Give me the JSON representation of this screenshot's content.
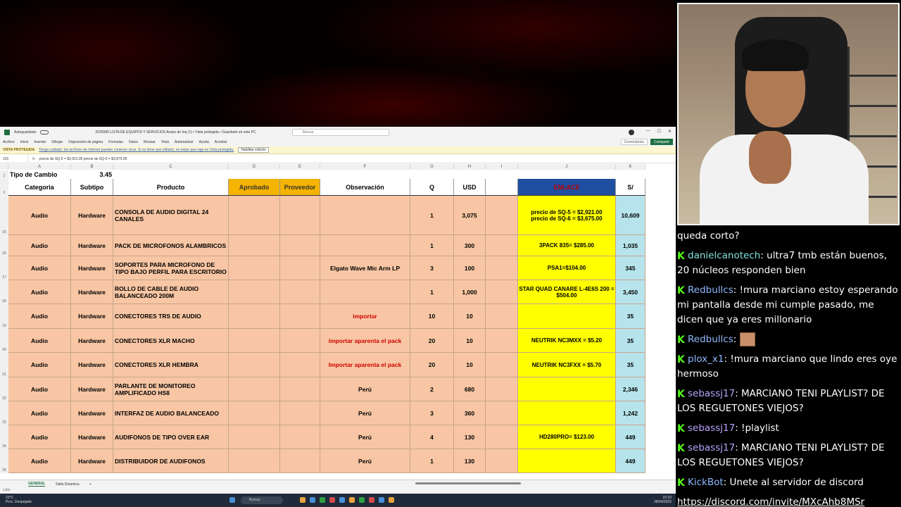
{
  "excel": {
    "title": "2025085 LISTA DE EQUIPOS Y SERVICIOS Arsiyo de Inq (1) • Vista protegida • Guardado en este PC",
    "autosave": "Autoguardado",
    "search_placeholder": "Buscar",
    "ribbon_tabs": [
      "Archivo",
      "Inicio",
      "Insertar",
      "Dibujar",
      "Disposición de página",
      "Fórmulas",
      "Datos",
      "Revisar",
      "Vista",
      "Automatizar",
      "Ayuda",
      "Acrobat"
    ],
    "comments_label": "Comentarios",
    "share_label": "Compartir",
    "protected_view": {
      "label": "VISTA PROTEGIDA",
      "message": "Tenga cuidado: los archivos de Internet pueden contener virus. Si no tiene que editarlo, es mejor que siga en Vista protegida.",
      "button": "Habilitar edición"
    },
    "namebox": "J15",
    "formula": "precio de SQ-5 = $2,921.00    precio de SQ-6 = $3,675.00",
    "columns": [
      "A",
      "B",
      "C",
      "D",
      "E",
      "F",
      "G",
      "H",
      "I",
      "J",
      "K"
    ],
    "row1": {
      "label": "Tipo de Cambio",
      "value": "3.45"
    },
    "headers": {
      "categoria": "Categoria",
      "subtipo": "Subtipo",
      "producto": "Producto",
      "aprobado": "Aprobado",
      "proveedor": "Proveedor",
      "observacion": "Observación",
      "q": "Q",
      "usd": "USD",
      "j": "ENLACE",
      "soles": "S/"
    },
    "rows": [
      {
        "num": "15",
        "cat": "Audio",
        "sub": "Hardware",
        "prod": "CONSOLA DE AUDIO DIGITAL 24 CANALES",
        "obs": "",
        "q": "1",
        "usd": "3,075",
        "j": "precio de SQ-5 = $2,921.00\nprecio de SQ-6 = $3,675.00",
        "s": "10,609"
      },
      {
        "num": "16",
        "cat": "Audio",
        "sub": "Hardware",
        "prod": "PACK DE MICROFONOS ALAMBRICOS",
        "obs": "",
        "q": "1",
        "usd": "300",
        "j": "3PACK 835= $285.00",
        "s": "1,035"
      },
      {
        "num": "17",
        "cat": "Audio",
        "sub": "Hardware",
        "prod": "SOPORTES PARA MICROFONO DE TIPO BAJO PERFIL PARA ESCRITORIO",
        "obs": "Elgato Wave Mic Arm LP",
        "q": "3",
        "usd": "100",
        "j": "PSA1=$104.00",
        "s": "345"
      },
      {
        "num": "18",
        "cat": "Audio",
        "sub": "Hardware",
        "prod": "ROLLO DE CABLE DE AUDIO BALANCEADO 200M",
        "obs": "",
        "q": "1",
        "usd": "1,000",
        "j": "STAR QUAD CANARE L-4E6S 200 = $504.00",
        "s": "3,450"
      },
      {
        "num": "19",
        "cat": "Audio",
        "sub": "Hardware",
        "prod": "CONECTORES TRS DE AUDIO",
        "obs": "importar",
        "q": "10",
        "usd": "10",
        "j": "",
        "s": "35"
      },
      {
        "num": "20",
        "cat": "Audio",
        "sub": "Hardware",
        "prod": "CONECTORES XLR MACHO",
        "obs": "importar aparenta el pack",
        "q": "20",
        "usd": "10",
        "j": "NEUTRIK NC3MXX = $5.20",
        "s": "35"
      },
      {
        "num": "21",
        "cat": "Audio",
        "sub": "Hardware",
        "prod": "CONECTORES XLR HEMBRA",
        "obs": "Importar aparenta el pack",
        "q": "20",
        "usd": "10",
        "j": "NEUTRIK NC3FXX = $5.70",
        "s": "35"
      },
      {
        "num": "22",
        "cat": "Audio",
        "sub": "Hardware",
        "prod": "PARLANTE DE MONITOREO AMPLIFICADO HS8",
        "obs": "Perú",
        "q": "2",
        "usd": "680",
        "j": "",
        "s": "2,346"
      },
      {
        "num": "23",
        "cat": "Audio",
        "sub": "Hardware",
        "prod": "INTERFAZ DE AUDIO BALANCEADO",
        "obs": "Perú",
        "q": "3",
        "usd": "360",
        "j": "",
        "s": "1,242"
      },
      {
        "num": "24",
        "cat": "Audio",
        "sub": "Hardware",
        "prod": "AUDIFONOS DE TIPO OVER EAR",
        "obs": "Perú",
        "q": "4",
        "usd": "130",
        "j": "HD280PRO= $123.00",
        "s": "449"
      },
      {
        "num": "25",
        "cat": "Audio",
        "sub": "Hardware",
        "prod": "DISTRIBUIDOR DE AUDIFONOS",
        "obs": "Perú",
        "q": "1",
        "usd": "130",
        "j": "",
        "s": "449"
      }
    ],
    "sheet_tabs": [
      "GENERAL",
      "Tabla Dinámica"
    ],
    "status": "Listo",
    "taskbar": {
      "weather_temp": "22°C",
      "weather_desc": "Prnc. Despejado",
      "search": "Buscar",
      "lang": "ESP LAA",
      "time": "22:10",
      "date": "28/04/2025"
    }
  },
  "chat": {
    "messages": [
      {
        "user": "",
        "text": "queda corto?",
        "badge": false
      },
      {
        "user": "danielcanotech",
        "color": "u-cyan",
        "text": "ultra7 tmb están buenos, 20 núcleos responden bien",
        "badge": true
      },
      {
        "user": "Redbullcs",
        "color": "u-blue",
        "text": "!mura marciano estoy esperando mi pantalla desde mi cumple pasado, me dicen que ya eres millonario",
        "badge": true
      },
      {
        "user": "Redbullcs",
        "color": "u-blue",
        "text": "",
        "badge": true,
        "emote": true
      },
      {
        "user": "plox_x1",
        "color": "u-blue",
        "text": "!mura marciano que lindo eres oye hermoso",
        "badge": true
      },
      {
        "user": "sebassj17",
        "color": "u-purple",
        "text": "MARCIANO TENI PLAYLIST? DE LOS REGUETONES VIEJOS?",
        "badge": true
      },
      {
        "user": "sebassj17",
        "color": "u-purple",
        "text": "!playlist",
        "badge": true
      },
      {
        "user": "sebassj17",
        "color": "u-purple",
        "text": "MARCIANO TENI PLAYLIST? DE LOS REGUETONES VIEJOS?",
        "badge": true
      },
      {
        "user": "KickBot",
        "color": "u-blue",
        "text": "Unete al servidor de discord",
        "badge": true
      },
      {
        "user": "",
        "text": "https://discord.com/invite/MXcAhb8MSr",
        "badge": false,
        "link": true
      }
    ]
  }
}
